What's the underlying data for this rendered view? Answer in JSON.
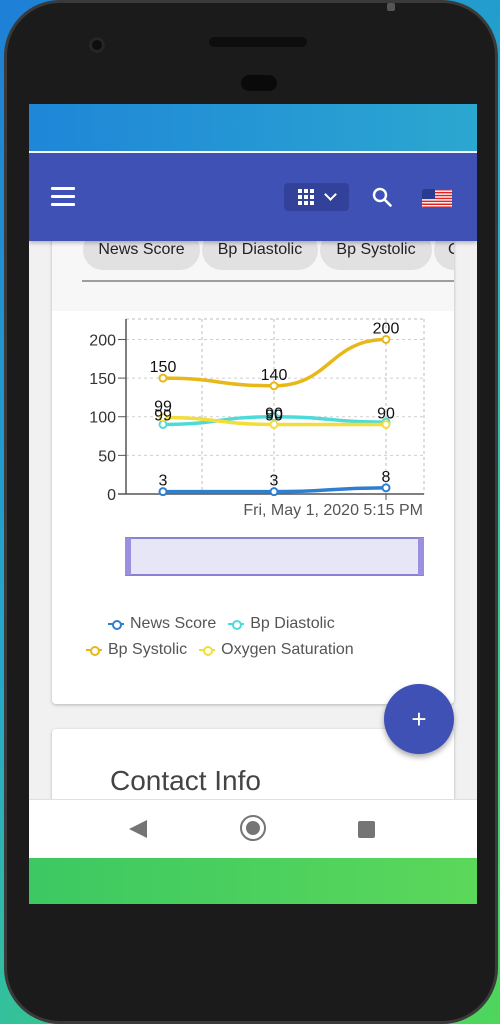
{
  "app_bar": {
    "menu_icon": "hamburger-menu-icon",
    "view_icon": "grid-icon",
    "search_icon": "search-icon",
    "language_flag": "us-flag-icon",
    "color": "#3f51b5"
  },
  "chips": [
    {
      "label": "News Score"
    },
    {
      "label": "Bp Diastolic"
    },
    {
      "label": "Bp Systolic"
    },
    {
      "label": "Oxyg"
    }
  ],
  "chart_data": {
    "type": "line",
    "x_label": "Fri, May 1, 2020 5:15 PM",
    "ylim": [
      0,
      220
    ],
    "y_ticks": [
      "0",
      "50",
      "100",
      "150",
      "200"
    ],
    "grid": true,
    "series": [
      {
        "name": "News Score",
        "color": "#2f7fd0",
        "values": [
          3,
          3,
          8
        ],
        "labels": [
          "3",
          "3",
          "8"
        ]
      },
      {
        "name": "Bp Diastolic",
        "color": "#4ddbd9",
        "values": [
          90,
          100,
          93
        ],
        "labels": [
          "",
          "",
          ""
        ]
      },
      {
        "name": "Bp Systolic",
        "color": "#e8b818",
        "values": [
          150,
          140,
          200
        ],
        "labels": [
          "150",
          "140",
          "200"
        ]
      },
      {
        "name": "Oxygen Saturation",
        "color": "#f2dd3a",
        "values": [
          99,
          90,
          90
        ],
        "labels": [
          "99",
          "90",
          "90"
        ]
      }
    ],
    "overlap_labels": [
      "99",
      "90"
    ]
  },
  "legend": [
    {
      "label": "News Score"
    },
    {
      "label": "Bp Diastolic"
    },
    {
      "label": "Bp Systolic"
    },
    {
      "label": "Oxygen Saturation"
    }
  ],
  "contact": {
    "title": "Contact Info"
  },
  "fab": {
    "label": "+"
  },
  "nav": {
    "back": "back-icon",
    "home": "home-icon",
    "recent": "recent-apps-icon"
  }
}
